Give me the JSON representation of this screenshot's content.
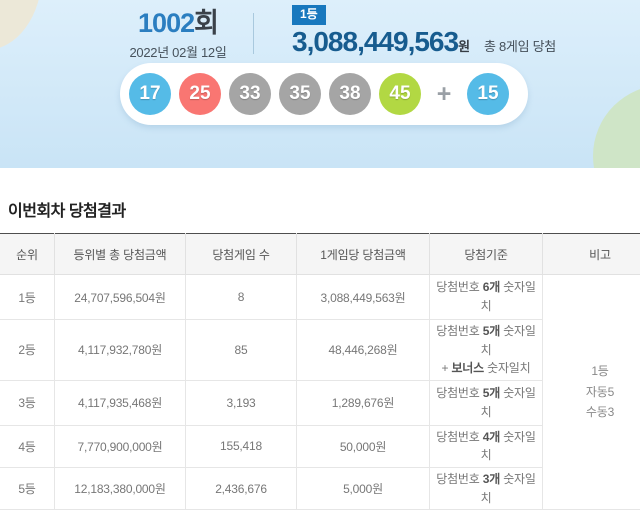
{
  "hero": {
    "round": "1002",
    "round_suffix": "회",
    "date": "2022년 02월 12일",
    "rank_badge": "1등",
    "prize_amount": "3,088,449,563",
    "prize_unit": "원",
    "total_games": "총 8게임 당첨",
    "balls": [
      {
        "num": "17",
        "color": "#55bbe7"
      },
      {
        "num": "25",
        "color": "#f97672"
      },
      {
        "num": "33",
        "color": "#a5a5a5"
      },
      {
        "num": "35",
        "color": "#a5a5a5"
      },
      {
        "num": "38",
        "color": "#a5a5a5"
      },
      {
        "num": "45",
        "color": "#b2d843"
      }
    ],
    "plus_sign": "+",
    "bonus_ball": {
      "num": "15",
      "color": "#55bbe7"
    }
  },
  "results": {
    "section_title": "이번회차 당첨결과",
    "columns": [
      "순위",
      "등위별 총 당첨금액",
      "당첨게임 수",
      "1게임당 당첨금액",
      "당첨기준",
      "비고"
    ],
    "rows": [
      {
        "rank": "1등",
        "total": "24,707,596,504원",
        "games": "8",
        "per_game": "3,088,449,563원",
        "crit_pre": "당첨번호 ",
        "crit_bold": "6개",
        "crit_post": " 숫자일치"
      },
      {
        "rank": "2등",
        "total": "4,117,932,780원",
        "games": "85",
        "per_game": "48,446,268원",
        "crit_pre": "당첨번호 ",
        "crit_bold": "5개",
        "crit_post": " 숫자일치",
        "crit2_pre": "+ ",
        "crit2_bold": "보너스",
        "crit2_post": " 숫자일치"
      },
      {
        "rank": "3등",
        "total": "4,117,935,468원",
        "games": "3,193",
        "per_game": "1,289,676원",
        "crit_pre": "당첨번호 ",
        "crit_bold": "5개",
        "crit_post": " 숫자일치"
      },
      {
        "rank": "4등",
        "total": "7,770,900,000원",
        "games": "155,418",
        "per_game": "50,000원",
        "crit_pre": "당첨번호 ",
        "crit_bold": "4개",
        "crit_post": " 숫자일치"
      },
      {
        "rank": "5등",
        "total": "12,183,380,000원",
        "games": "2,436,676",
        "per_game": "5,000원",
        "crit_pre": "당첨번호 ",
        "crit_bold": "3개",
        "crit_post": " 숫자일치"
      }
    ],
    "note_lines": [
      "1등",
      "자동5",
      "수동3"
    ]
  },
  "colors": {
    "hero_bg_top": "#ddeffb",
    "hero_bg_bottom": "#c9e4f6",
    "badge_blue": "#1878be",
    "prize_text": "#175c8f",
    "round_number_blue": "#2b7ec0",
    "ball_blue": "#55bbe7",
    "ball_red": "#f97672",
    "ball_gray": "#a5a5a5",
    "ball_green": "#b2d843"
  }
}
